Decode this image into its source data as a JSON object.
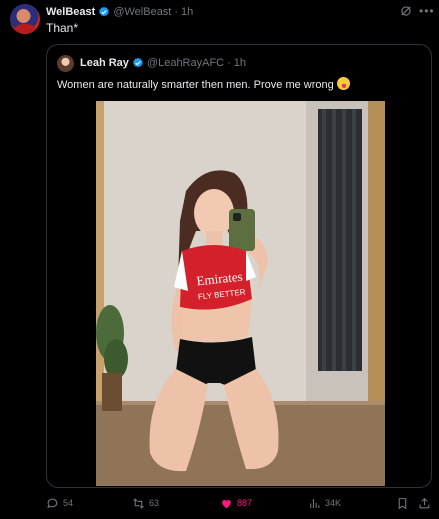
{
  "tweet": {
    "author_name": "WelBeast",
    "author_handle": "@WelBeast",
    "separator": "·",
    "time": "1h",
    "text": "Than*"
  },
  "quote": {
    "author_name": "Leah Ray",
    "author_handle": "@LeahRayAFC",
    "separator": "·",
    "time": "1h",
    "text": "Women are naturally smarter then men. Prove me wrong"
  },
  "photo": {
    "shirt_text_line1": "Emirates",
    "shirt_text_line2": "FLY BETTER"
  },
  "actions": {
    "replies": "54",
    "reposts": "63",
    "likes": "887",
    "views": "34K"
  },
  "colors": {
    "background": "#000000",
    "text": "#e7e9ea",
    "muted": "#71767b",
    "verified": "#1d9bf0",
    "like": "#f91880",
    "border": "#2f3336"
  },
  "icons": [
    "verified-badge-icon",
    "grok-icon",
    "more-icon",
    "reply-icon",
    "repost-icon",
    "like-icon",
    "views-icon",
    "bookmark-icon",
    "share-icon"
  ]
}
